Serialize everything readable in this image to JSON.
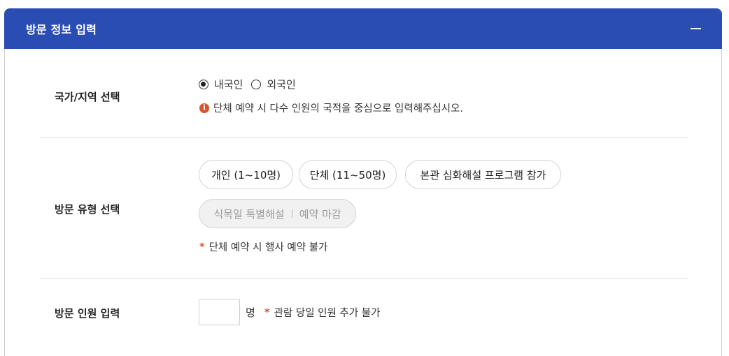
{
  "header": {
    "title": "방문 정보 입력",
    "collapse_icon": "minus-icon"
  },
  "country": {
    "label": "국가/지역 선택",
    "options": [
      {
        "label": "내국인",
        "checked": true
      },
      {
        "label": "외국인",
        "checked": false
      }
    ],
    "notice": "단체 예약 시 다수 인원의 국적을 중심으로 입력해주십시오.",
    "notice_icon_glyph": "i"
  },
  "visit_type": {
    "label": "방문 유형 선택",
    "chips": [
      {
        "label": "개인 (1~10명)"
      },
      {
        "label": "단체 (11~50명)"
      },
      {
        "label": "본관 심화해설 프로그램 참가"
      }
    ],
    "disabled_chip": {
      "label": "식목일 특별해설",
      "status": "예약 마감"
    },
    "note": "단체 예약 시 행사 예약 불가"
  },
  "people": {
    "label": "방문 인원 입력",
    "value": "",
    "unit": "명",
    "note": "관람 당일 인원 추가 불가"
  },
  "colors": {
    "header_bg": "#2a4db3",
    "accent_red": "#d9542f"
  }
}
